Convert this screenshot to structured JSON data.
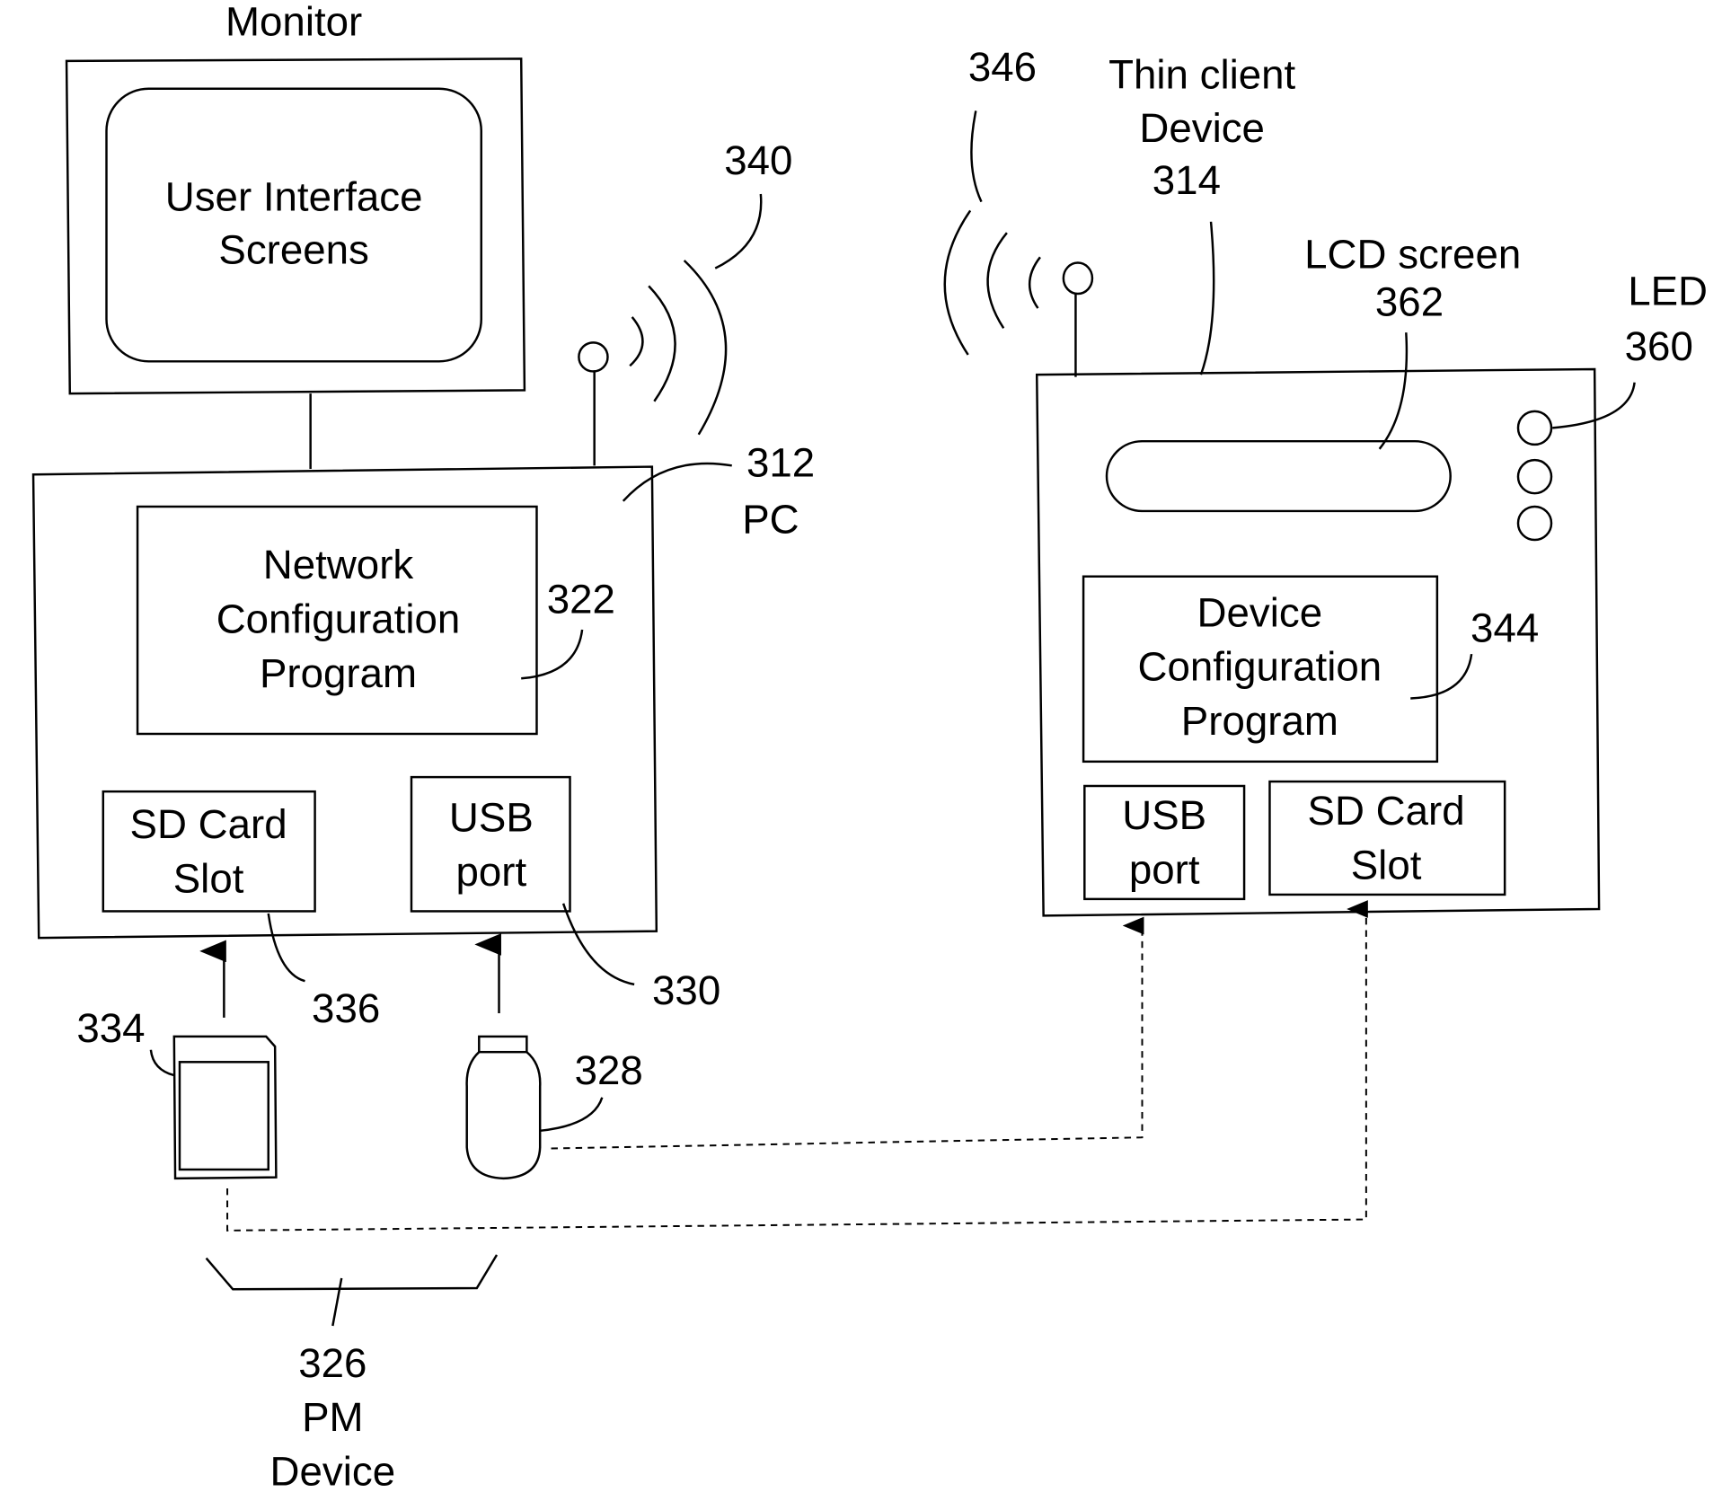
{
  "diagram": {
    "monitor": {
      "label": "Monitor",
      "screen_line1": "User Interface",
      "screen_line2": "Screens"
    },
    "pc": {
      "ref": "312",
      "label": "PC",
      "program_line1": "Network",
      "program_line2": "Configuration",
      "program_line3": "Program",
      "program_ref": "322",
      "sd_line1": "SD Card",
      "sd_line2": "Slot",
      "sd_ref": "336",
      "usb_line1": "USB",
      "usb_line2": "port",
      "usb_ref": "330",
      "wireless_ref": "340"
    },
    "thin_client": {
      "line1": "Thin client",
      "line2": "Device",
      "ref": "314",
      "wireless_ref": "346",
      "lcd_label": "LCD screen",
      "lcd_ref": "362",
      "led_label": "LED",
      "led_ref": "360",
      "program_line1": "Device",
      "program_line2": "Configuration",
      "program_line3": "Program",
      "program_ref": "344",
      "usb_line1": "USB",
      "usb_line2": "port",
      "sd_line1": "SD Card",
      "sd_line2": "Slot"
    },
    "sd_card_ref": "334",
    "usb_stick_ref": "328",
    "pm_device": {
      "ref": "326",
      "line1": "PM",
      "line2": "Device"
    }
  }
}
